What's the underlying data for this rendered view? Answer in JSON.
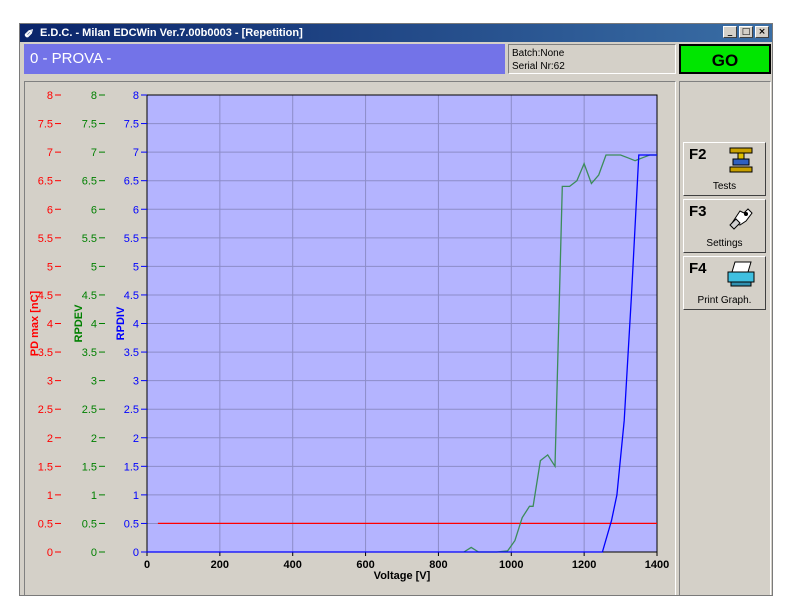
{
  "window": {
    "title": "E.D.C. - Milan  EDCWin Ver.7.00b0003 - [Repetition]",
    "controls": [
      "_",
      "□",
      "×"
    ]
  },
  "header": {
    "test_name": "0 - PROVA -",
    "batch": "Batch:None",
    "serial": "Serial Nr:62",
    "status": "GO",
    "status_color": "#00e600"
  },
  "function_keys": [
    {
      "key": "F2",
      "label": "Tests",
      "icon": "test-stand-icon"
    },
    {
      "key": "F3",
      "label": "Settings",
      "icon": "settings-hand-icon"
    },
    {
      "key": "F4",
      "label": "Print Graph.",
      "icon": "printer-icon"
    }
  ],
  "chart_data": {
    "type": "line",
    "xlabel": "Voltage [V]",
    "xlim": [
      0,
      1400
    ],
    "x_ticks": [
      "0",
      "200",
      "400",
      "600",
      "800",
      "1000",
      "1200",
      "1400"
    ],
    "y_axes": [
      {
        "label": "PD max [nC]",
        "color": "#ff0000"
      },
      {
        "label": "RPDEV",
        "color": "#008000"
      },
      {
        "label": "RPDIV",
        "color": "#0000ff"
      }
    ],
    "ylim": [
      0,
      8
    ],
    "y_ticks": [
      "0",
      "0.5",
      "1",
      "1.5",
      "2",
      "2.5",
      "3",
      "3.5",
      "4",
      "4.5",
      "5",
      "5.5",
      "6",
      "6.5",
      "7",
      "7.5",
      "8"
    ],
    "grid": true,
    "plot_background": "#b4b4ff",
    "series": [
      {
        "color": "#ff0000",
        "x": [
          30,
          1400
        ],
        "y": [
          0.5,
          0.5
        ]
      },
      {
        "color": "#3c8c5a",
        "x": [
          870,
          890,
          910,
          960,
          990,
          1010,
          1030,
          1050,
          1060,
          1080,
          1100,
          1120,
          1140,
          1160,
          1180,
          1200,
          1220,
          1240,
          1260,
          1280,
          1300,
          1320,
          1340,
          1360,
          1380,
          1400
        ],
        "y": [
          0,
          0.08,
          0,
          0,
          0.02,
          0.2,
          0.6,
          0.8,
          0.8,
          1.6,
          1.7,
          1.5,
          6.4,
          6.4,
          6.5,
          6.8,
          6.45,
          6.6,
          6.95,
          6.95,
          6.95,
          6.9,
          6.85,
          6.9,
          6.95,
          6.95
        ]
      },
      {
        "color": "#0000ff",
        "x": [
          0,
          1250,
          1275,
          1290,
          1310,
          1330,
          1350,
          1370,
          1400
        ],
        "y": [
          0,
          0,
          0.55,
          1.0,
          2.3,
          4.5,
          6.95,
          6.95,
          6.95
        ]
      }
    ]
  }
}
